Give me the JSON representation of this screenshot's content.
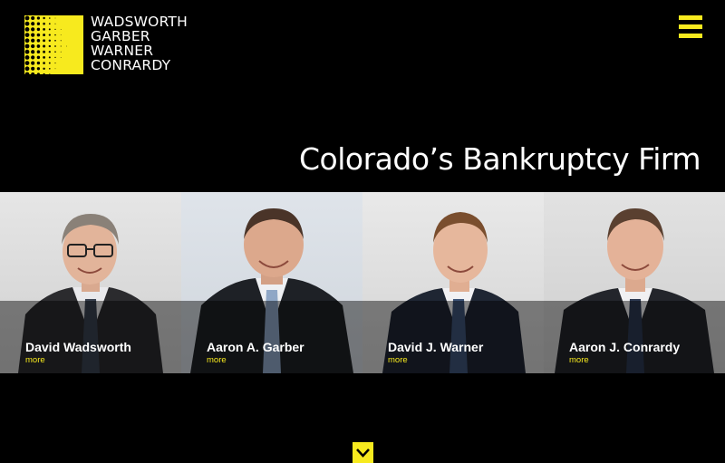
{
  "brand": {
    "name_lines": [
      "WADSWORTH",
      "GARBER",
      "WARNER",
      "CONRARDY"
    ],
    "accent_color": "#f7ea1e",
    "logo_icon": "halftone-dots-icon"
  },
  "header": {
    "menu_icon": "hamburger-menu-icon"
  },
  "hero": {
    "headline": "Colorado’s Bankruptcy Firm"
  },
  "attorneys": [
    {
      "name": "David Wadsworth",
      "more_label": "more"
    },
    {
      "name": "Aaron A. Garber",
      "more_label": "more"
    },
    {
      "name": "David J. Warner",
      "more_label": "more"
    },
    {
      "name": "Aaron J. Conrardy",
      "more_label": "more"
    }
  ],
  "footer": {
    "scroll_icon": "chevron-down-icon"
  }
}
